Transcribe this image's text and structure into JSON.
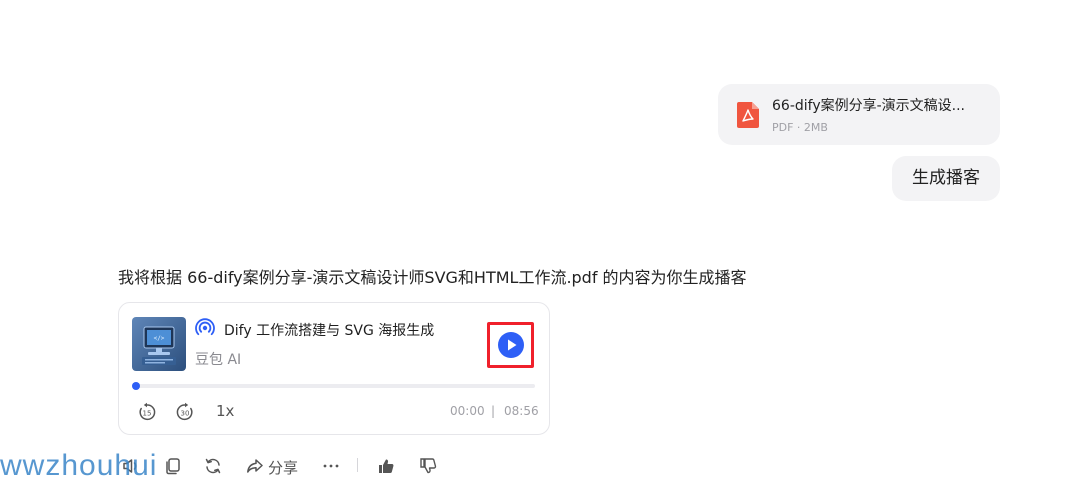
{
  "user_file": {
    "name": "66-dify案例分享-演示文稿设计师SVG和HTML工作流.pdf",
    "name_display": "66-dify案例分享-演示文稿设...",
    "meta": "PDF · 2MB",
    "icon": "pdf-icon",
    "icon_color": "#f0553f"
  },
  "user_message": "生成播客",
  "assistant": {
    "reply": "我将根据 66-dify案例分享-演示文稿设计师SVG和HTML工作流.pdf 的内容为你生成播客",
    "podcast": {
      "title": "Dify 工作流搭建与 SVG 海报生成",
      "author": "豆包 AI",
      "podcast_icon": "podcast-signal-icon",
      "cover": "podcast-cover-image",
      "play_icon": "play-icon",
      "highlight_color": "#f0202b",
      "accent_color": "#2e5ff6",
      "progress": 0.0,
      "rewind_icon": "rewind-15-icon",
      "forward_icon": "forward-30-icon",
      "speed": "1x",
      "time_current": "00:00",
      "time_separator": "|",
      "time_total": "08:56"
    }
  },
  "actions": {
    "speaker_icon": "speaker-icon",
    "copy_icon": "copy-icon",
    "refresh_icon": "refresh-icon",
    "share_icon": "share-icon",
    "share_label": "分享",
    "more_icon": "more-icon",
    "thumbs_up_icon": "thumbs-up-icon",
    "thumbs_down_icon": "thumbs-down-icon"
  },
  "watermark": "wwzhouhui"
}
